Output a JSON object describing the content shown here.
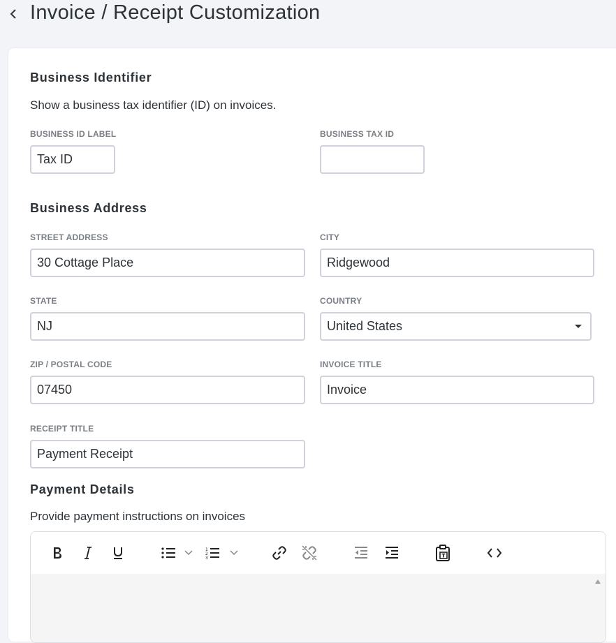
{
  "header": {
    "title": "Invoice / Receipt Customization"
  },
  "business_identifier": {
    "title": "Business Identifier",
    "description": "Show a business tax identifier (ID) on invoices.",
    "id_label": {
      "label": "BUSINESS ID LABEL",
      "value": "Tax ID"
    },
    "tax_id": {
      "label": "BUSINESS TAX ID",
      "value": ""
    }
  },
  "business_address": {
    "title": "Business Address",
    "street": {
      "label": "STREET ADDRESS",
      "value": "30 Cottage Place"
    },
    "city": {
      "label": "CITY",
      "value": "Ridgewood"
    },
    "state": {
      "label": "STATE",
      "value": "NJ"
    },
    "country": {
      "label": "COUNTRY",
      "value": "United States"
    },
    "zip": {
      "label": "ZIP / POSTAL CODE",
      "value": "07450"
    },
    "invoice_title": {
      "label": "INVOICE TITLE",
      "value": "Invoice"
    },
    "receipt_title": {
      "label": "RECEIPT TITLE",
      "value": "Payment Receipt"
    }
  },
  "payment_details": {
    "title": "Payment Details",
    "description": "Provide payment instructions on invoices",
    "toolbar_icons": [
      "bold-icon",
      "italic-icon",
      "underline-icon",
      "bullet-list-icon",
      "numbered-list-icon",
      "link-icon",
      "unlink-icon",
      "outdent-icon",
      "indent-icon",
      "paste-text-icon",
      "source-code-icon"
    ]
  },
  "colors": {
    "page_background": "#f3f4f8",
    "card_background": "#ffffff",
    "field_border": "#cfd2db",
    "label_text": "#7a7f85",
    "body_text": "#2e3338",
    "editor_background": "#f5f5f5"
  }
}
